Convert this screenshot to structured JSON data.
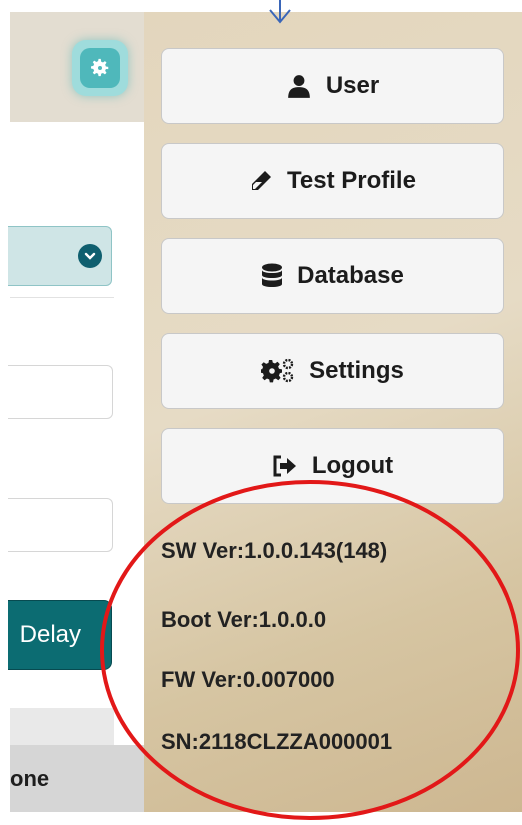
{
  "left_panel": {
    "delay_label": "Delay",
    "bottom_label": "one"
  },
  "menu": {
    "items": [
      {
        "label": "User",
        "icon": "user-icon"
      },
      {
        "label": "Test Profile",
        "icon": "test-profile-icon"
      },
      {
        "label": "Database",
        "icon": "database-icon"
      },
      {
        "label": "Settings",
        "icon": "settings-gears-icon"
      },
      {
        "label": "Logout",
        "icon": "logout-icon"
      }
    ]
  },
  "version_info": {
    "sw_ver": "SW Ver:1.0.0.143(148)",
    "boot_ver": "Boot Ver:1.0.0.0",
    "fw_ver": "FW Ver:0.007000",
    "sn": "SN:2118CLZZA000001"
  },
  "colors": {
    "accent": "#0c6c72",
    "menu_bg": "#e3d6bd",
    "annotation": "#e21818"
  }
}
